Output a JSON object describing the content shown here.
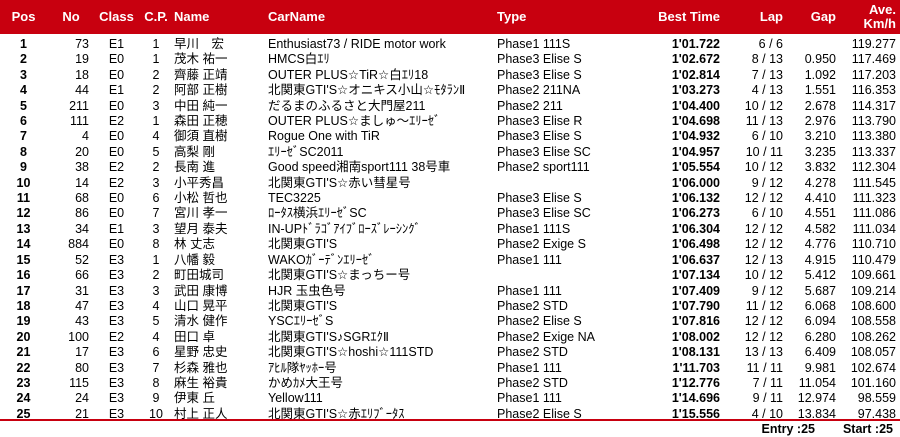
{
  "headers": {
    "pos": "Pos",
    "no": "No",
    "class": "Class",
    "cp": "C.P.",
    "name": "Name",
    "car": "CarName",
    "type": "Type",
    "best": "Best Time",
    "lap": "Lap",
    "gap": "Gap",
    "ave1": "Ave.",
    "ave2": "Km/h"
  },
  "rows": [
    {
      "pos": "1",
      "no": "73",
      "cls": "E1",
      "cp": "1",
      "name": "早川　宏",
      "car": "Enthusiast73 / RIDE motor work",
      "type": "Phase1 111S",
      "best": "1'01.722",
      "lap": "6 / 6",
      "gap": "",
      "ave": "119.277"
    },
    {
      "pos": "2",
      "no": "19",
      "cls": "E0",
      "cp": "1",
      "name": "茂木 祐一",
      "car": "HMCS白ｴﾘ",
      "type": "Phase3 Elise S",
      "best": "1'02.672",
      "lap": "8 / 13",
      "gap": "0.950",
      "ave": "117.469"
    },
    {
      "pos": "3",
      "no": "18",
      "cls": "E0",
      "cp": "2",
      "name": "齊藤 正靖",
      "car": "OUTER PLUS☆TiR☆白ｴﾘ18",
      "type": "Phase3 Elise S",
      "best": "1'02.814",
      "lap": "7 / 13",
      "gap": "1.092",
      "ave": "117.203"
    },
    {
      "pos": "4",
      "no": "44",
      "cls": "E1",
      "cp": "2",
      "name": "阿部 正樹",
      "car": "北関東GTI'S☆オニキス小山☆ﾓﾀﾗﾝⅡ",
      "type": "Phase2 211NA",
      "best": "1'03.273",
      "lap": "4 / 13",
      "gap": "1.551",
      "ave": "116.353"
    },
    {
      "pos": "5",
      "no": "211",
      "cls": "E0",
      "cp": "3",
      "name": "中田 純一",
      "car": "だるまのふるさと大門屋211",
      "type": "Phase2 211",
      "best": "1'04.400",
      "lap": "10 / 12",
      "gap": "2.678",
      "ave": "114.317"
    },
    {
      "pos": "6",
      "no": "111",
      "cls": "E2",
      "cp": "1",
      "name": "森田 正穂",
      "car": "OUTER PLUS☆ましゅ～ｴﾘｰｾﾞ",
      "type": "Phase3 Elise R",
      "best": "1'04.698",
      "lap": "11 / 13",
      "gap": "2.976",
      "ave": "113.790"
    },
    {
      "pos": "7",
      "no": "4",
      "cls": "E0",
      "cp": "4",
      "name": "御須 直樹",
      "car": "Rogue One with TiR",
      "type": "Phase3 Elise S",
      "best": "1'04.932",
      "lap": "6 / 10",
      "gap": "3.210",
      "ave": "113.380"
    },
    {
      "pos": "8",
      "no": "20",
      "cls": "E0",
      "cp": "5",
      "name": "高梨 剛",
      "car": "ｴﾘｰｾﾞSC2011",
      "type": "Phase3 Elise SC",
      "best": "1'04.957",
      "lap": "10 / 11",
      "gap": "3.235",
      "ave": "113.337"
    },
    {
      "pos": "9",
      "no": "38",
      "cls": "E2",
      "cp": "2",
      "name": "長南 進",
      "car": "Good speed湘南sport111 38号車",
      "type": "Phase2 sport111",
      "best": "1'05.554",
      "lap": "10 / 12",
      "gap": "3.832",
      "ave": "112.304"
    },
    {
      "pos": "10",
      "no": "14",
      "cls": "E2",
      "cp": "3",
      "name": "小平秀昌",
      "car": "北関東GTI'S☆赤い彗星号",
      "type": "",
      "best": "1'06.000",
      "lap": "9 / 12",
      "gap": "4.278",
      "ave": "111.545"
    },
    {
      "pos": "11",
      "no": "68",
      "cls": "E0",
      "cp": "6",
      "name": "小松 哲也",
      "car": "TEC3225",
      "type": "Phase3 Elise S",
      "best": "1'06.132",
      "lap": "12 / 12",
      "gap": "4.410",
      "ave": "111.323"
    },
    {
      "pos": "12",
      "no": "86",
      "cls": "E0",
      "cp": "7",
      "name": "宮川 孝一",
      "car": "ﾛｰﾀｽ横浜ｴﾘｰｾﾞSC",
      "type": "Phase3 Elise SC",
      "best": "1'06.273",
      "lap": "6 / 10",
      "gap": "4.551",
      "ave": "111.086"
    },
    {
      "pos": "13",
      "no": "34",
      "cls": "E1",
      "cp": "3",
      "name": "望月 泰夫",
      "car": "IN-UPﾄﾞﾗｺﾞｱｲﾌﾞﾛｰｽﾞﾚｰｼﾝｸﾞ",
      "type": "Phase1 111S",
      "best": "1'06.304",
      "lap": "12 / 12",
      "gap": "4.582",
      "ave": "111.034"
    },
    {
      "pos": "14",
      "no": "884",
      "cls": "E0",
      "cp": "8",
      "name": "林 丈志",
      "car": "北関東GTI'S",
      "type": "Phase2 Exige S",
      "best": "1'06.498",
      "lap": "12 / 12",
      "gap": "4.776",
      "ave": "110.710"
    },
    {
      "pos": "15",
      "no": "52",
      "cls": "E3",
      "cp": "1",
      "name": "八幡 毅",
      "car": "WAKOｶﾞｰﾃﾞﾝｴﾘｰｾﾞ",
      "type": "Phase1 111",
      "best": "1'06.637",
      "lap": "12 / 13",
      "gap": "4.915",
      "ave": "110.479"
    },
    {
      "pos": "16",
      "no": "66",
      "cls": "E3",
      "cp": "2",
      "name": "町田城司",
      "car": "北関東GTI'S☆まっちー号",
      "type": "",
      "best": "1'07.134",
      "lap": "10 / 12",
      "gap": "5.412",
      "ave": "109.661"
    },
    {
      "pos": "17",
      "no": "31",
      "cls": "E3",
      "cp": "3",
      "name": "武田 康博",
      "car": "HJR 玉虫色号",
      "type": "Phase1 111",
      "best": "1'07.409",
      "lap": "9 / 12",
      "gap": "5.687",
      "ave": "109.214"
    },
    {
      "pos": "18",
      "no": "47",
      "cls": "E3",
      "cp": "4",
      "name": "山口 晃平",
      "car": "北関東GTI'S",
      "type": "Phase2 STD",
      "best": "1'07.790",
      "lap": "11 / 12",
      "gap": "6.068",
      "ave": "108.600"
    },
    {
      "pos": "19",
      "no": "43",
      "cls": "E3",
      "cp": "5",
      "name": "清水 健作",
      "car": "YSCｴﾘｰｾﾞS",
      "type": "Phase2 Elise S",
      "best": "1'07.816",
      "lap": "12 / 12",
      "gap": "6.094",
      "ave": "108.558"
    },
    {
      "pos": "20",
      "no": "100",
      "cls": "E2",
      "cp": "4",
      "name": "田口 卓",
      "car": "北関東GTI'S♪SGRｴｸⅡ",
      "type": "Phase2 Exige NA",
      "best": "1'08.002",
      "lap": "12 / 12",
      "gap": "6.280",
      "ave": "108.262"
    },
    {
      "pos": "21",
      "no": "17",
      "cls": "E3",
      "cp": "6",
      "name": "星野 忠史",
      "car": "北関東GTI'S☆hoshi☆111STD",
      "type": "Phase2 STD",
      "best": "1'08.131",
      "lap": "13 / 13",
      "gap": "6.409",
      "ave": "108.057"
    },
    {
      "pos": "22",
      "no": "80",
      "cls": "E3",
      "cp": "7",
      "name": "杉森 雅也",
      "car": "ｱﾋﾙ隊ﾔｯﾎｰ号",
      "type": "Phase1 111",
      "best": "1'11.703",
      "lap": "11 / 11",
      "gap": "9.981",
      "ave": "102.674"
    },
    {
      "pos": "23",
      "no": "115",
      "cls": "E3",
      "cp": "8",
      "name": "麻生 裕貴",
      "car": "かめｶﾒ大王号",
      "type": "Phase2 STD",
      "best": "1'12.776",
      "lap": "7 / 11",
      "gap": "11.054",
      "ave": "101.160"
    },
    {
      "pos": "24",
      "no": "24",
      "cls": "E3",
      "cp": "9",
      "name": "伊東 丘",
      "car": "Yellow111",
      "type": "Phase1 111",
      "best": "1'14.696",
      "lap": "9 / 11",
      "gap": "12.974",
      "ave": "98.559"
    },
    {
      "pos": "25",
      "no": "21",
      "cls": "E3",
      "cp": "10",
      "name": "村上 正人",
      "car": "北関東GTI'S☆赤ｴﾘﾌﾞｰﾀｽ",
      "type": "Phase2 Elise S",
      "best": "1'15.556",
      "lap": "4 / 10",
      "gap": "13.834",
      "ave": "97.438"
    }
  ],
  "footer": {
    "entry": "Entry :25",
    "start": "Start :25"
  },
  "colors": {
    "header_bg": "#c8000f",
    "header_text": "#ffffff"
  }
}
